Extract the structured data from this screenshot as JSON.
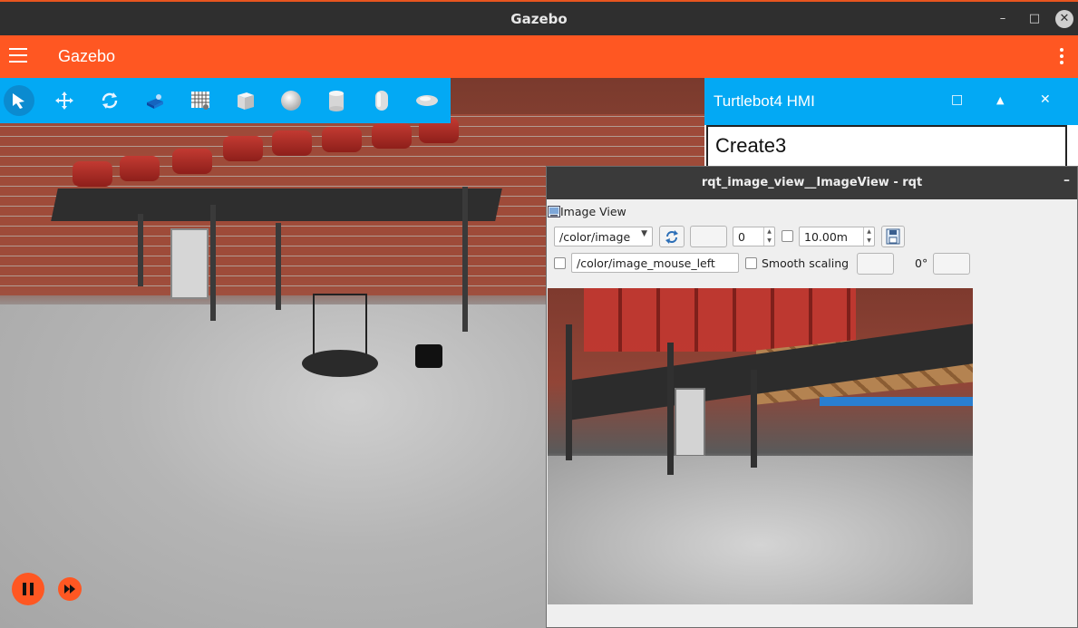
{
  "window": {
    "title": "Gazebo",
    "controls": {
      "minimize": "–",
      "maximize": "□",
      "close": "✕"
    }
  },
  "appbar": {
    "title": "Gazebo"
  },
  "toolbar": {
    "tools": [
      {
        "icon": "select-arrow-icon"
      },
      {
        "icon": "translate-icon"
      },
      {
        "icon": "rotate-icon"
      },
      {
        "icon": "transform-control-icon"
      },
      {
        "icon": "grid-icon"
      },
      {
        "icon": "box-shape-icon"
      },
      {
        "icon": "sphere-shape-icon"
      },
      {
        "icon": "cylinder-shape-icon"
      },
      {
        "icon": "capsule-shape-icon"
      },
      {
        "icon": "ellipsoid-shape-icon"
      }
    ]
  },
  "hmi": {
    "title": "Turtlebot4 HMI",
    "header_text": "Create3"
  },
  "rqt": {
    "title": "rqt_image_view__ImageView - rqt",
    "plugin_label": "Image View",
    "topic": "/color/image",
    "spin_value": "0",
    "duration": "10.00m",
    "mouse_topic": "/color/image_mouse_left",
    "smooth_label": "Smooth scaling",
    "rotation": "0°"
  },
  "colors": {
    "accent": "#ff5722",
    "toolbar": "#03a9f4",
    "titlebar": "#2f2f2f"
  }
}
